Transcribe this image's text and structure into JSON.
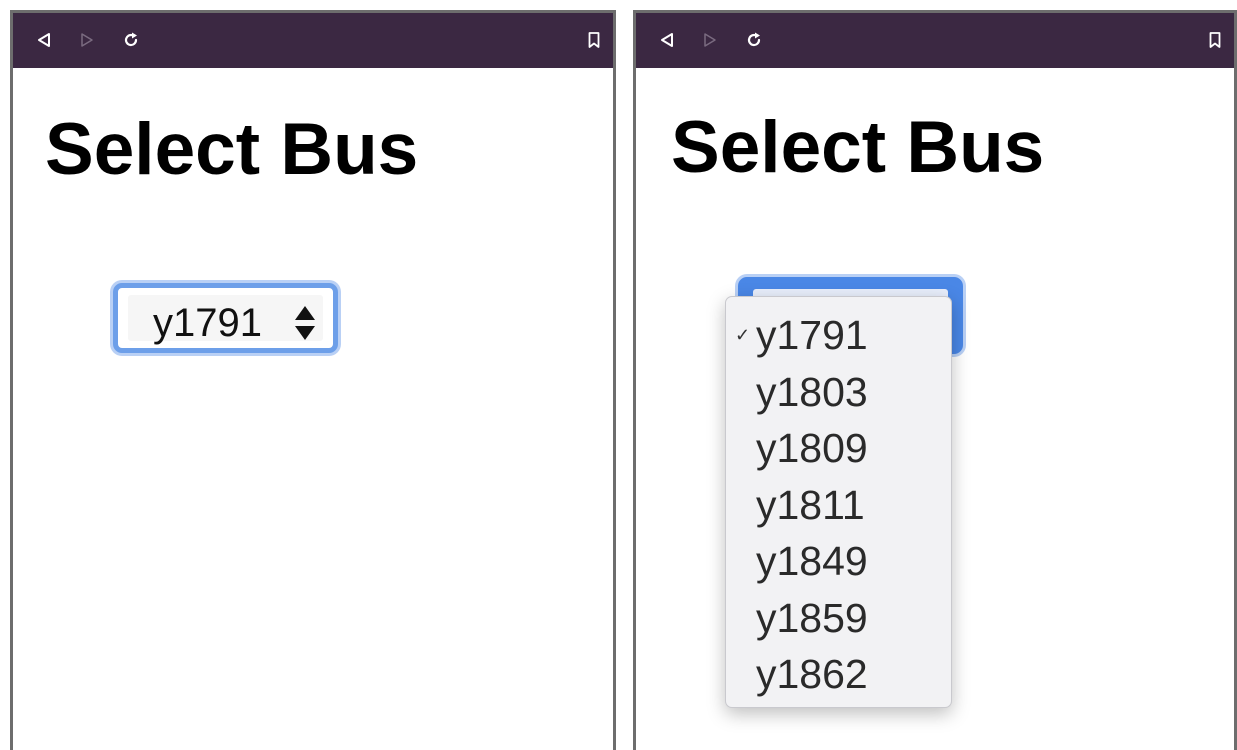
{
  "panels": [
    {
      "titlebar": {
        "back_icon": "back-triangle-icon",
        "forward_icon": "forward-triangle-icon",
        "reload_icon": "reload-icon",
        "bookmark_icon": "bookmark-icon"
      },
      "page_title": "Select Bus",
      "select": {
        "value": "y1791",
        "expanded": false
      }
    },
    {
      "titlebar": {
        "back_icon": "back-triangle-icon",
        "forward_icon": "forward-triangle-icon",
        "reload_icon": "reload-icon",
        "bookmark_icon": "bookmark-icon"
      },
      "page_title": "Select Bus",
      "select": {
        "value": "y1791",
        "expanded": true,
        "checkmark": "✓",
        "options": [
          "y1791",
          "y1803",
          "y1809",
          "y1811",
          "y1849",
          "y1859",
          "y1862"
        ]
      }
    }
  ],
  "colors": {
    "titlebar": "#3b2842",
    "focus_ring": "#6d9fe9",
    "window_border": "#6d6d6d",
    "menu_background": "#f2f2f4"
  }
}
